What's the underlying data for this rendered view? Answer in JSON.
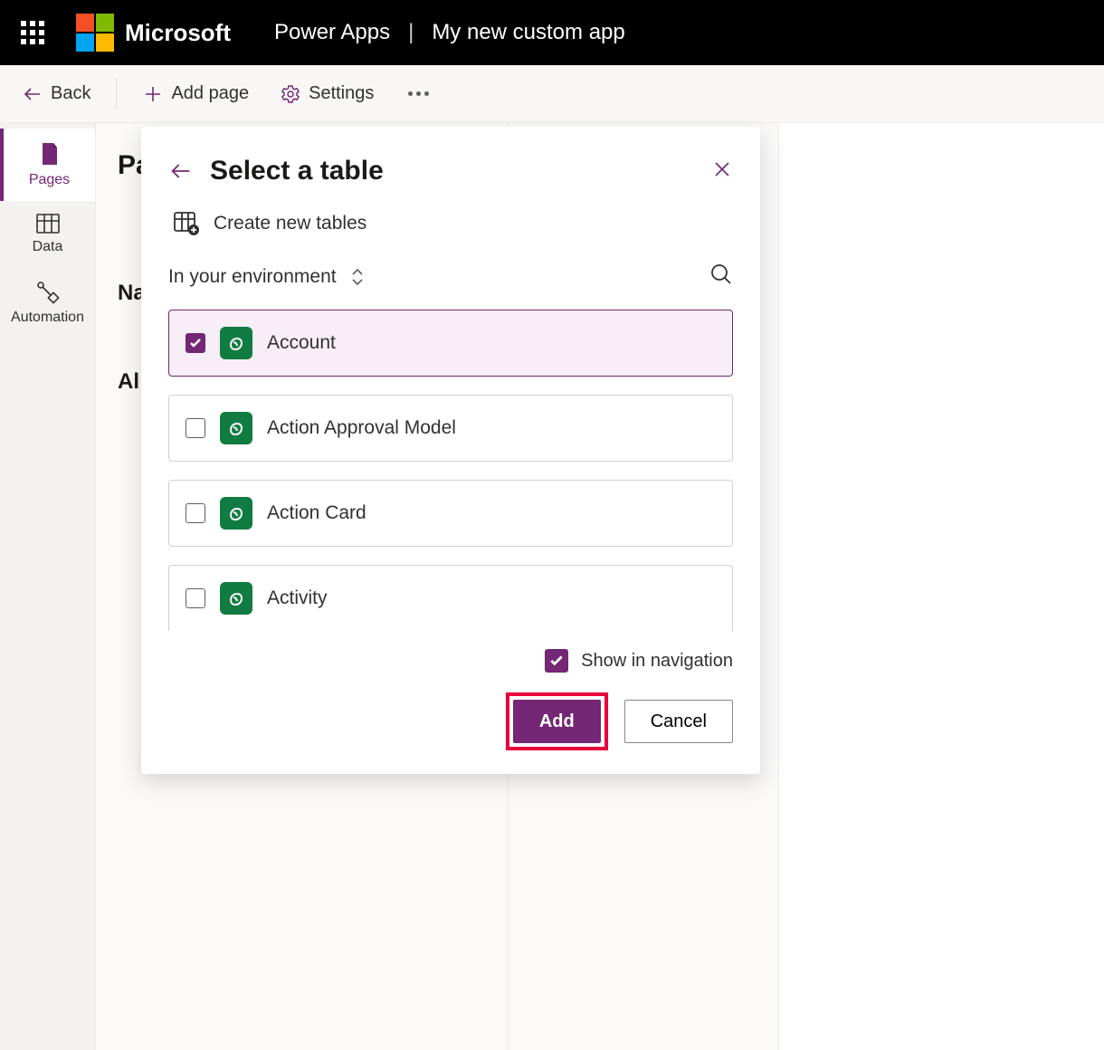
{
  "topbar": {
    "brand": "Microsoft",
    "crumb1": "Power Apps",
    "crumb2": "My new custom app"
  },
  "cmdbar": {
    "back": "Back",
    "add_page": "Add page",
    "settings": "Settings"
  },
  "rail": {
    "items": [
      {
        "label": "Pages"
      },
      {
        "label": "Data"
      },
      {
        "label": "Automation"
      }
    ]
  },
  "background": {
    "pages_heading": "Pa",
    "na": "Na",
    "al": "Al"
  },
  "dialog": {
    "title": "Select a table",
    "create_new": "Create new tables",
    "env_label": "In your environment",
    "tables": [
      {
        "label": "Account",
        "selected": true
      },
      {
        "label": "Action Approval Model",
        "selected": false
      },
      {
        "label": "Action Card",
        "selected": false
      },
      {
        "label": "Activity",
        "selected": false
      }
    ],
    "show_in_nav": "Show in navigation",
    "add": "Add",
    "cancel": "Cancel"
  }
}
